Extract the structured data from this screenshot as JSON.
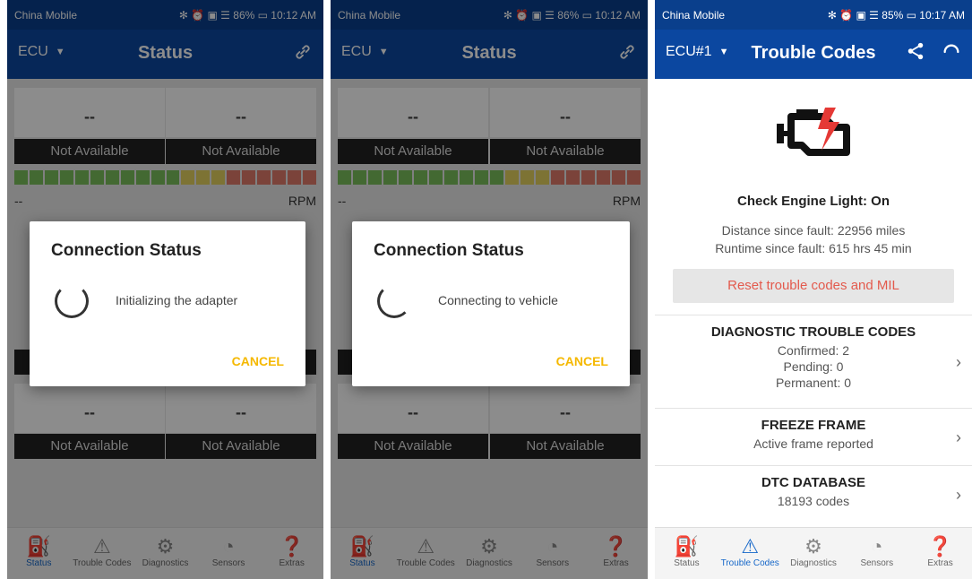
{
  "screens": [
    {
      "status_bar": {
        "carrier": "China Mobile",
        "right": "✻ ⏰ ▣ ☰ 86% ▭ 10:12 AM"
      },
      "app_bar": {
        "ecu": "ECU",
        "title": "Status"
      },
      "gauges": {
        "top_left": "--",
        "top_right": "--",
        "bottom_left": "--",
        "bottom_right": "--"
      },
      "na_label": "Not Available",
      "rpm": {
        "value": "--",
        "unit": "RPM"
      },
      "dialog": {
        "title": "Connection Status",
        "message": "Initializing the adapter",
        "cancel": "CANCEL"
      }
    },
    {
      "status_bar": {
        "carrier": "China Mobile",
        "right": "✻ ⏰ ▣ ☰ 86% ▭ 10:12 AM"
      },
      "app_bar": {
        "ecu": "ECU",
        "title": "Status"
      },
      "gauges": {
        "top_left": "--",
        "top_right": "--",
        "bottom_left": "--",
        "bottom_right": "--"
      },
      "na_label": "Not Available",
      "rpm": {
        "value": "--",
        "unit": "RPM"
      },
      "dialog": {
        "title": "Connection Status",
        "message": "Connecting to vehicle",
        "cancel": "CANCEL"
      }
    },
    {
      "status_bar": {
        "carrier": "China Mobile",
        "right": "✻ ⏰ ▣ ☰ 85% ▭ 10:17 AM"
      },
      "app_bar": {
        "ecu": "ECU#1",
        "title": "Trouble Codes"
      },
      "check_engine": "Check Engine Light: On",
      "distance": "Distance since fault: 22956 miles",
      "runtime": "Runtime since fault: 615 hrs 45 min",
      "reset_button": "Reset trouble codes and MIL",
      "dtc": {
        "title": "DIAGNOSTIC TROUBLE CODES",
        "confirmed": "Confirmed: 2",
        "pending": "Pending: 0",
        "permanent": "Permanent: 0"
      },
      "freeze": {
        "title": "FREEZE FRAME",
        "sub": "Active frame reported"
      },
      "dtcdb": {
        "title": "DTC DATABASE",
        "sub": "18193 codes"
      }
    }
  ],
  "nav": [
    "Status",
    "Trouble Codes",
    "Diagnostics",
    "Sensors",
    "Extras"
  ],
  "colors": {
    "appbar": "#0b47a0",
    "accent": "#f5b800",
    "active_nav": "#1667c9",
    "reset_text": "#e35a4d"
  }
}
